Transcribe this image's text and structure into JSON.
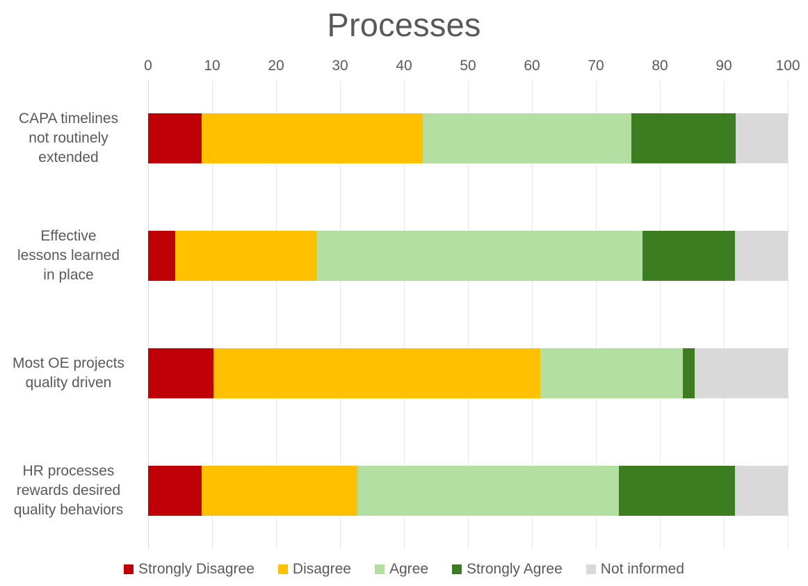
{
  "chart_data": {
    "type": "bar",
    "subtype": "stacked-horizontal-100",
    "title": "Processes",
    "xlabel": "",
    "ylabel": "",
    "xlim": [
      0,
      100
    ],
    "xticks": [
      0,
      10,
      20,
      30,
      40,
      50,
      60,
      70,
      80,
      90,
      100
    ],
    "grid": true,
    "legend_position": "bottom",
    "categories": [
      "CAPA timelines not routinely extended",
      "Effective lessons learned in place",
      "Most OE projects quality driven",
      "HR processes rewards desired quality behaviors"
    ],
    "category_lines": [
      [
        "CAPA timelines",
        "not routinely",
        "extended"
      ],
      [
        "Effective",
        "lessons learned",
        "in place"
      ],
      [
        "Most OE projects",
        "quality driven"
      ],
      [
        "HR processes",
        "rewards desired",
        "quality behaviors"
      ]
    ],
    "series": [
      {
        "name": "Strongly Disagree",
        "color": "#C00007",
        "values": [
          8.4,
          4.2,
          10.2,
          8.4
        ]
      },
      {
        "name": "Disagree",
        "color": "#FFC000",
        "values": [
          34.5,
          22.2,
          51.1,
          24.3
        ]
      },
      {
        "name": "Agree",
        "color": "#B3E0A1",
        "values": [
          32.6,
          50.9,
          22.3,
          40.9
        ]
      },
      {
        "name": "Strongly Agree",
        "color": "#3C7D22",
        "values": [
          16.3,
          14.4,
          1.8,
          18.1
        ]
      },
      {
        "name": "Not informed",
        "color": "#D9D9D9",
        "values": [
          8.2,
          8.3,
          14.6,
          8.3
        ]
      }
    ]
  },
  "colors": {
    "text": "#595959",
    "gridline": "#E8E8E8",
    "background": "#FFFFFF"
  }
}
